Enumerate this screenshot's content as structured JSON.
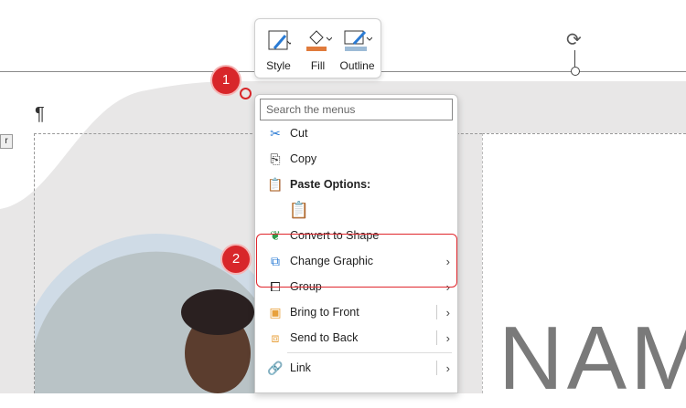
{
  "ribbon": {
    "style": "Style",
    "fill": "Fill",
    "outline": "Outline",
    "fill_color": "#e07b3c",
    "outline_color": "#9dbbd6"
  },
  "doc": {
    "pilcrow": "¶",
    "tag": "r",
    "name_text": "NAM"
  },
  "callouts": [
    "1",
    "2"
  ],
  "menu": {
    "search_placeholder": "Search the menus",
    "items": [
      {
        "label": "Cut",
        "icon": "scissors-icon"
      },
      {
        "label": "Copy",
        "icon": "copy-icon"
      },
      {
        "label": "Paste Options:",
        "icon": "paste-icon"
      },
      {
        "label": "Convert to Shape",
        "icon": "convert-shape-icon"
      },
      {
        "label": "Change Graphic",
        "icon": "change-graphic-icon"
      },
      {
        "label": "Group",
        "icon": "group-icon"
      },
      {
        "label": "Bring to Front",
        "icon": "bring-front-icon"
      },
      {
        "label": "Send to Back",
        "icon": "send-back-icon"
      },
      {
        "label": "Link",
        "icon": "link-icon"
      }
    ]
  },
  "colors": {
    "accent": "#d8262a"
  }
}
